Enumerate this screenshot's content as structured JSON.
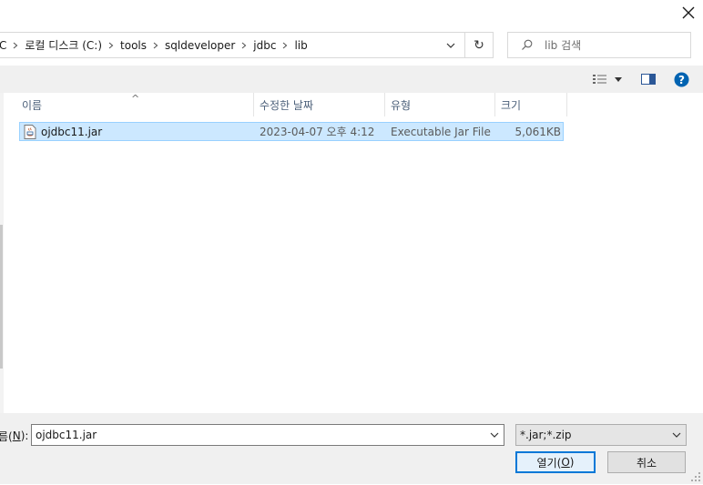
{
  "window": {
    "close_symbol": "✕"
  },
  "address": {
    "crumbs": [
      "C",
      "로컬 디스크 (C:)",
      "tools",
      "sqldeveloper",
      "jdbc",
      "lib"
    ],
    "refresh_symbol": "↻"
  },
  "search": {
    "placeholder": "lib 검색"
  },
  "columns": {
    "name": "이름",
    "date": "수정한 날짜",
    "type": "유형",
    "size": "크기"
  },
  "files": [
    {
      "name": "ojdbc11.jar",
      "date": "2023-04-07 오후 4:12",
      "type": "Executable Jar File",
      "size": "5,061KB"
    }
  ],
  "filename": {
    "label_prefix": "름(",
    "label_key": "N",
    "label_suffix": "):",
    "value": "ojdbc11.jar"
  },
  "filetype": {
    "value": "*.jar;*.zip"
  },
  "buttons": {
    "open_prefix": "열기(",
    "open_key": "O",
    "open_suffix": ")",
    "cancel": "취소"
  },
  "colors": {
    "selection": "#cce8ff",
    "selection_border": "#99d1ff",
    "help": "#0063b1",
    "accent": "#0078d7"
  }
}
